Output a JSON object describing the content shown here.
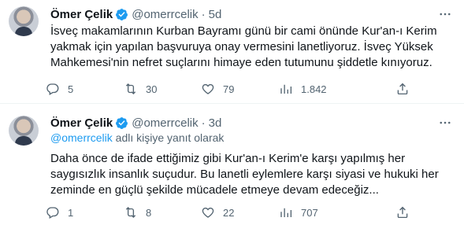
{
  "tweets": [
    {
      "name": "Ömer Çelik",
      "handle": "@omerrcelik",
      "time": "5d",
      "text": "İsveç makamlarının Kurban Bayramı günü bir cami önünde Kur'an-ı Kerim yakmak için yapılan başvuruya onay vermesini lanetliyoruz. İsveç Yüksek Mahkemesi'nin nefret suçlarını himaye eden tutumunu şiddetle kınıyoruz.",
      "replies": "5",
      "retweets": "30",
      "likes": "79",
      "views": "1.842"
    },
    {
      "name": "Ömer Çelik",
      "handle": "@omerrcelik",
      "time": "3d",
      "replying_handle": "@omerrcelik",
      "replying_suffix": " adlı kişiye yanıt olarak",
      "text": "Daha önce de ifade ettiğimiz gibi Kur'an-ı Kerim'e karşı yapılmış her saygısızlık insanlık suçudur. Bu lanetli eylemlere karşı siyasi ve hukuki her zeminde en güçlü şekilde mücadele etmeye devam edeceğiz...",
      "replies": "1",
      "retweets": "8",
      "likes": "22",
      "views": "707"
    }
  ],
  "dot": "·",
  "icons": {
    "verified": "verified-badge-icon",
    "more": "more-horizontal-icon",
    "reply": "reply-icon",
    "retweet": "retweet-icon",
    "like": "heart-icon",
    "views": "views-chart-icon",
    "share": "share-icon"
  },
  "colors": {
    "accent": "#1d9bf0",
    "text": "#0f1419",
    "secondary": "#536471",
    "divider": "#eff3f4"
  }
}
